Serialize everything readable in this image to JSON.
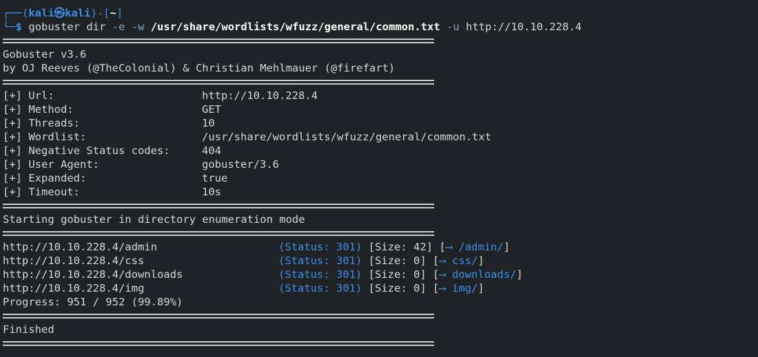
{
  "prompt": {
    "top_open": "┌──(",
    "user": "kali",
    "at": "㉿",
    "host": "kali",
    "close_open": ")-[",
    "dir": "~",
    "close": "]",
    "bottom": "└─",
    "dollar": "$",
    "command": "gobuster dir",
    "flag_e": "-e",
    "flag_w": "-w",
    "wordlist": "/usr/share/wordlists/wfuzz/general/common.txt",
    "flag_u": "-u",
    "url": "http://10.10.228.4"
  },
  "banner": {
    "version": "Gobuster v3.6",
    "authors": "by OJ Reeves (@TheColonial) & Christian Mehlmauer (@firefart)"
  },
  "config": [
    {
      "label": "[+] Url:",
      "value": "http://10.10.228.4"
    },
    {
      "label": "[+] Method:",
      "value": "GET"
    },
    {
      "label": "[+] Threads:",
      "value": "10"
    },
    {
      "label": "[+] Wordlist:",
      "value": "/usr/share/wordlists/wfuzz/general/common.txt"
    },
    {
      "label": "[+] Negative Status codes:",
      "value": "404"
    },
    {
      "label": "[+] User Agent:",
      "value": "gobuster/3.6"
    },
    {
      "label": "[+] Expanded:",
      "value": "true"
    },
    {
      "label": "[+] Timeout:",
      "value": "10s"
    }
  ],
  "start_message": "Starting gobuster in directory enumeration mode",
  "results": [
    {
      "url": "http://10.10.228.4/admin",
      "status": "(Status: 301)",
      "size": "[Size: 42]",
      "open": "[",
      "arrow": "⟶",
      "target": "/admin/",
      "close": "]"
    },
    {
      "url": "http://10.10.228.4/css",
      "status": "(Status: 301)",
      "size": "[Size: 0]",
      "open": "[",
      "arrow": "⟶",
      "target": "css/",
      "close": "]"
    },
    {
      "url": "http://10.10.228.4/downloads",
      "status": "(Status: 301)",
      "size": "[Size: 0]",
      "open": "[",
      "arrow": "⟶",
      "target": "downloads/",
      "close": "]"
    },
    {
      "url": "http://10.10.228.4/img",
      "status": "(Status: 301)",
      "size": "[Size: 0]",
      "open": "[",
      "arrow": "⟶",
      "target": "img/",
      "close": "]"
    }
  ],
  "progress": "Progress: 951 / 952 (99.89%)",
  "finished": "Finished",
  "colors": {
    "background": "#202326",
    "prompt_accent": "#3b8eea",
    "text": "#d6d6d6"
  }
}
